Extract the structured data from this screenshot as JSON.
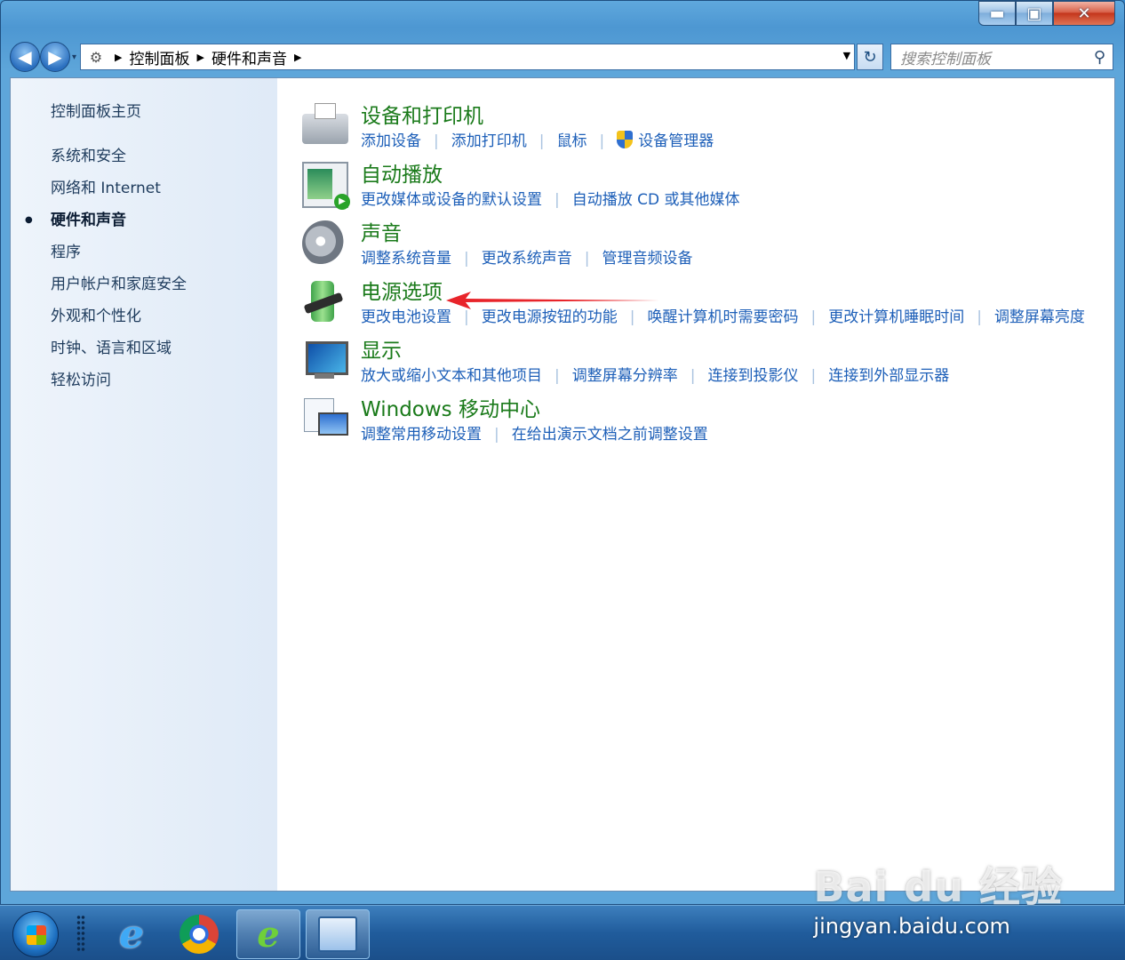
{
  "window": {
    "caption": {
      "minimize": "▬",
      "maximize": "▣",
      "close": "✕"
    }
  },
  "navbar": {
    "back_glyph": "◀",
    "forward_glyph": "▶",
    "history_glyph": "▾",
    "breadcrumb": [
      "控制面板",
      "硬件和声音"
    ],
    "breadcrumb_sep": "▶",
    "addr_drop": "▼",
    "refresh_glyph": "↻",
    "search_placeholder": "搜索控制面板",
    "search_icon": "⚲"
  },
  "sidebar": {
    "home": "控制面板主页",
    "items": [
      {
        "label": "系统和安全"
      },
      {
        "label": "网络和 Internet"
      },
      {
        "label": "硬件和声音",
        "active": true
      },
      {
        "label": "程序"
      },
      {
        "label": "用户帐户和家庭安全"
      },
      {
        "label": "外观和个性化"
      },
      {
        "label": "时钟、语言和区域"
      },
      {
        "label": "轻松访问"
      }
    ]
  },
  "categories": [
    {
      "title": "设备和打印机",
      "icon": "printer-icon",
      "links": [
        "添加设备",
        "添加打印机",
        "鼠标",
        "设备管理器"
      ]
    },
    {
      "title": "自动播放",
      "icon": "autoplay-icon",
      "links": [
        "更改媒体或设备的默认设置",
        "自动播放 CD 或其他媒体"
      ]
    },
    {
      "title": "声音",
      "icon": "speaker-icon",
      "links": [
        "调整系统音量",
        "更改系统声音",
        "管理音频设备"
      ]
    },
    {
      "title": "电源选项",
      "icon": "power-plug-icon",
      "links": [
        "更改电池设置",
        "更改电源按钮的功能",
        "唤醒计算机时需要密码",
        "更改计算机睡眠时间",
        "调整屏幕亮度"
      ]
    },
    {
      "title": "显示",
      "icon": "monitor-icon",
      "links": [
        "放大或缩小文本和其他项目",
        "调整屏幕分辨率",
        "连接到投影仪",
        "连接到外部显示器"
      ]
    },
    {
      "title": "Windows 移动中心",
      "icon": "mobility-center-icon",
      "links": [
        "调整常用移动设置",
        "在给出演示文档之前调整设置"
      ]
    }
  ],
  "taskbar": {
    "apps": [
      {
        "name": "internet-explorer",
        "glyph": "e"
      },
      {
        "name": "chrome"
      },
      {
        "name": "ie-green",
        "glyph": "e"
      },
      {
        "name": "control-panel"
      }
    ]
  },
  "watermark": {
    "logo": "Bai du 经验",
    "url": "jingyan.baidu.com"
  },
  "colors": {
    "category_title": "#1a7a1a",
    "link": "#1d5fb8",
    "annotation_arrow": "#e8242a"
  }
}
